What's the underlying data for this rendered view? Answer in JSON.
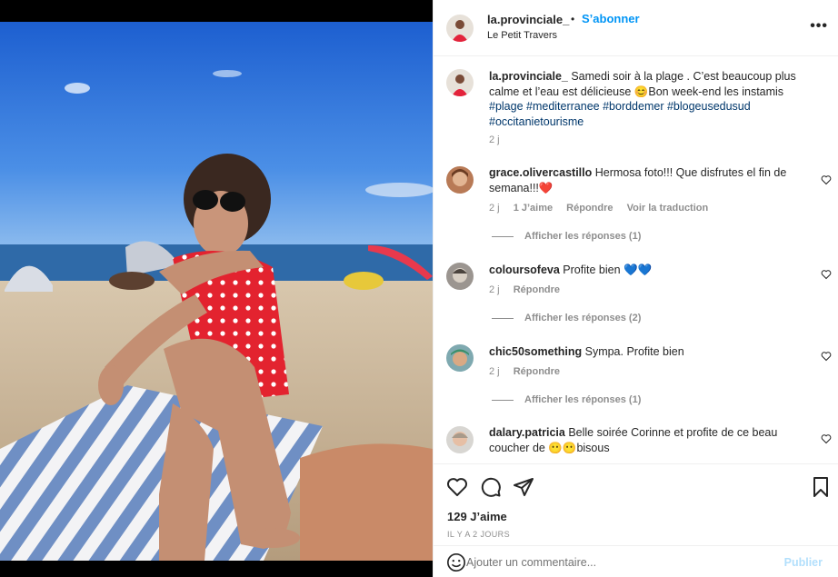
{
  "post": {
    "username": "la.provinciale_",
    "separator": "•",
    "follow_label": "S’abonner",
    "location": "Le Petit Travers",
    "more_label": "•••",
    "image_subject": "photo"
  },
  "caption": {
    "username": "la.provinciale_",
    "text": "Samedi soir à la plage . C’est beaucoup plus calme et l’eau est délicieuse 😊Bon week-end les instamis",
    "tags": "#plage #mediterranee #borddemer #blogeusedusud #occitanietourisme",
    "time": "2 j"
  },
  "comments": [
    {
      "username": "grace.olivercastillo",
      "text": "Hermosa foto!!! Que disfrutes el fin de semana!!!❤️",
      "time": "2 j",
      "likes": "1 J’aime",
      "reply": "Répondre",
      "translate": "Voir la traduction",
      "replies": "Afficher les réponses (1)"
    },
    {
      "username": "coloursofeva",
      "text": "Profite bien 💙💙",
      "time": "2 j",
      "reply": "Répondre",
      "replies": "Afficher les réponses (2)"
    },
    {
      "username": "chic50something",
      "text": "Sympa. Profite bien",
      "time": "2 j",
      "reply": "Répondre",
      "replies": "Afficher les réponses (1)"
    },
    {
      "username": "dalary.patricia",
      "text": "Belle soirée Corinne et profite de ce beau coucher de 😶😶bisous"
    }
  ],
  "stats": {
    "likes": "129 J’aime",
    "ago": "IL Y A 2 JOURS"
  },
  "composer": {
    "placeholder": "Ajouter un commentaire...",
    "publish_label": "Publier"
  },
  "icons": {
    "like": "heart-icon",
    "comment": "comment-icon",
    "share": "share-icon",
    "save": "bookmark-icon",
    "emoji": "emoji-icon",
    "more": "more-icon"
  },
  "colors": {
    "link_blue": "#0095f6",
    "hashtag": "#00376b",
    "muted": "#8e8e8e",
    "publish_disabled": "#b2dffc"
  }
}
